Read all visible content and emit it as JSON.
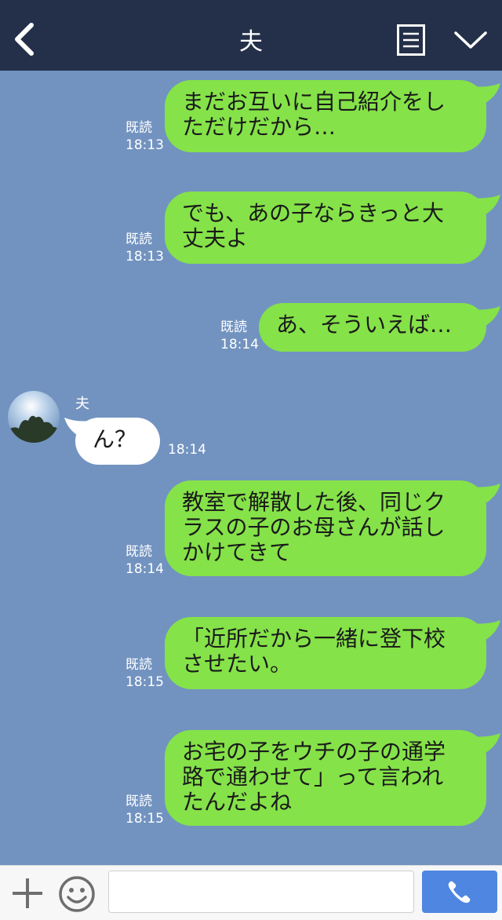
{
  "header": {
    "title": "夫",
    "back_icon": "chevron-left-icon",
    "menu_icon": "menu-list-icon",
    "collapse_icon": "chevron-down-icon",
    "background": "#243049"
  },
  "chat": {
    "background": "#7293c0",
    "outgoing_color": "#85e249",
    "incoming_color": "#ffffff",
    "sender_name": "夫",
    "messages": [
      {
        "direction": "out",
        "lines": [
          "まだお互いに自己紹介をし",
          "ただけだから…"
        ],
        "read": "既読",
        "time": "18:13"
      },
      {
        "direction": "out",
        "lines": [
          "でも、あの子ならきっと大",
          "丈夫よ"
        ],
        "read": "既読",
        "time": "18:13"
      },
      {
        "direction": "out",
        "lines": [
          "あ、そういえば…"
        ],
        "read": "既読",
        "time": "18:14"
      },
      {
        "direction": "in",
        "lines": [
          "ん？"
        ],
        "time": "18:14"
      },
      {
        "direction": "out",
        "lines": [
          "教室で解散した後、同じク",
          "ラスの子のお母さんが話し",
          "かけてきて"
        ],
        "read": "既読",
        "time": "18:14"
      },
      {
        "direction": "out",
        "lines": [
          "「近所だから一緒に登下校",
          "させたい。"
        ],
        "read": "既読",
        "time": "18:15"
      },
      {
        "direction": "out",
        "lines": [
          "お宅の子をウチの子の通学",
          "路で通わせて」って言われ",
          "たんだよね"
        ],
        "read": "既読",
        "time": "18:15"
      }
    ]
  },
  "footer": {
    "plus_icon": "plus-icon",
    "emoji_icon": "smile-icon",
    "input_value": "",
    "call_icon": "phone-icon",
    "call_color": "#4f86e1"
  }
}
